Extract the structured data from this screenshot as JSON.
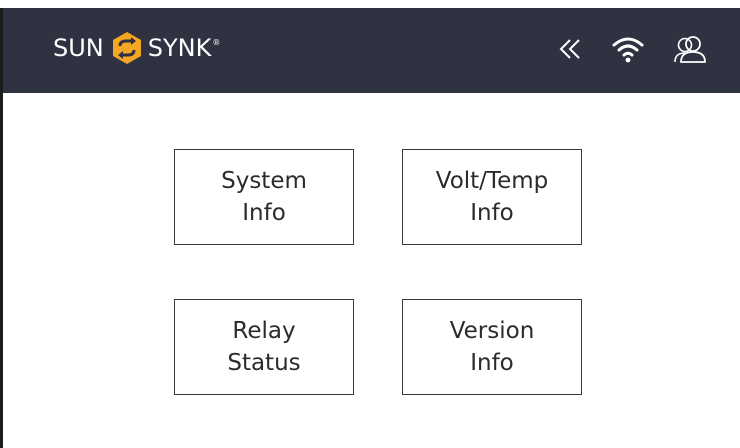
{
  "header": {
    "logo_left": "SUN",
    "logo_right": "SYNK",
    "logo_mark": "®",
    "brand_colors": {
      "bar": "#2f3241",
      "emblem": "#f5a623"
    },
    "icons": [
      "double-chevron-left-icon",
      "wifi-icon",
      "users-icon"
    ]
  },
  "menu": {
    "system_info": "System\nInfo",
    "volt_temp_info": "Volt/Temp\nInfo",
    "relay_status": "Relay\nStatus",
    "version_info": "Version\nInfo"
  }
}
